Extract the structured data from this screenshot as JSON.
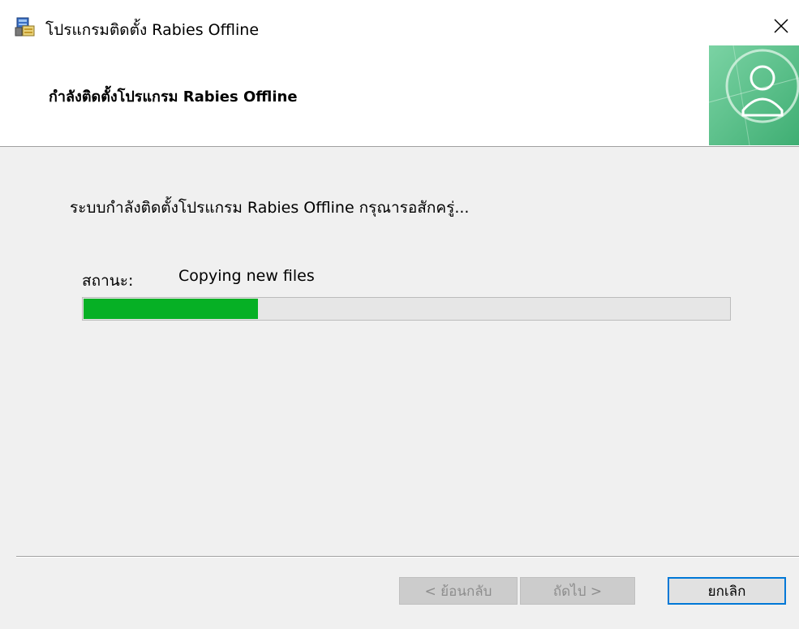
{
  "window": {
    "title": "โปรแกรมติดตั้ง Rabies Offline",
    "app_icon": "installer-icon",
    "close_icon": "close-icon"
  },
  "header": {
    "title": "กำลังติดตั้งโปรแกรม Rabies Offline",
    "logo_icon": "globe-user-icon"
  },
  "main": {
    "description": "ระบบกำลังติดตั้งโปรแกรม Rabies Offline กรุณารอสักครู่...",
    "status_label": "สถานะ:",
    "status_value": "Copying new files",
    "progress_fraction": 0.27,
    "progress_color": "#06b025"
  },
  "buttons": {
    "back_label": "< ย้อนกลับ",
    "next_label": "ถัดไป >",
    "cancel_label": "ยกเลิก"
  },
  "colors": {
    "accent": "#0078d7",
    "header_logo_green": "#5cc08a"
  }
}
